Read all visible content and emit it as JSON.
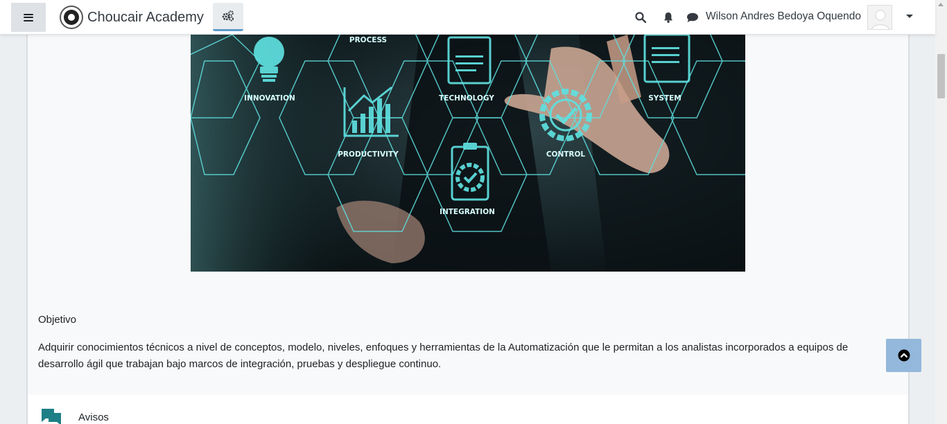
{
  "brand": {
    "name": "Choucair Academy"
  },
  "user": {
    "name": "Wilson Andres Bedoya Oquendo"
  },
  "hero": {
    "labels": [
      "PROCESS",
      "INNOVATION",
      "TECHNOLOGY",
      "SYSTEM",
      "PRODUCTIVITY",
      "CONTROL",
      "INTEGRATION"
    ]
  },
  "content": {
    "section_title": "Objetivo",
    "objective_text": "Adquirir conocimientos técnicos a nivel de conceptos, modelo, niveles, enfoques y herramientas de la Automatización que le permitan a los analistas incorporados a equipos de desarrollo ágil que trabajan bajo marcos de integración, pruebas y despliegue continuo."
  },
  "activities": [
    {
      "label": "Avisos",
      "icon": "forum-icon"
    }
  ],
  "colors": {
    "accent": "#5a99c8",
    "back_to_top": "#93b8db",
    "forum_icon": "#1f7f87",
    "hero_teal": "#5fe0e0"
  }
}
